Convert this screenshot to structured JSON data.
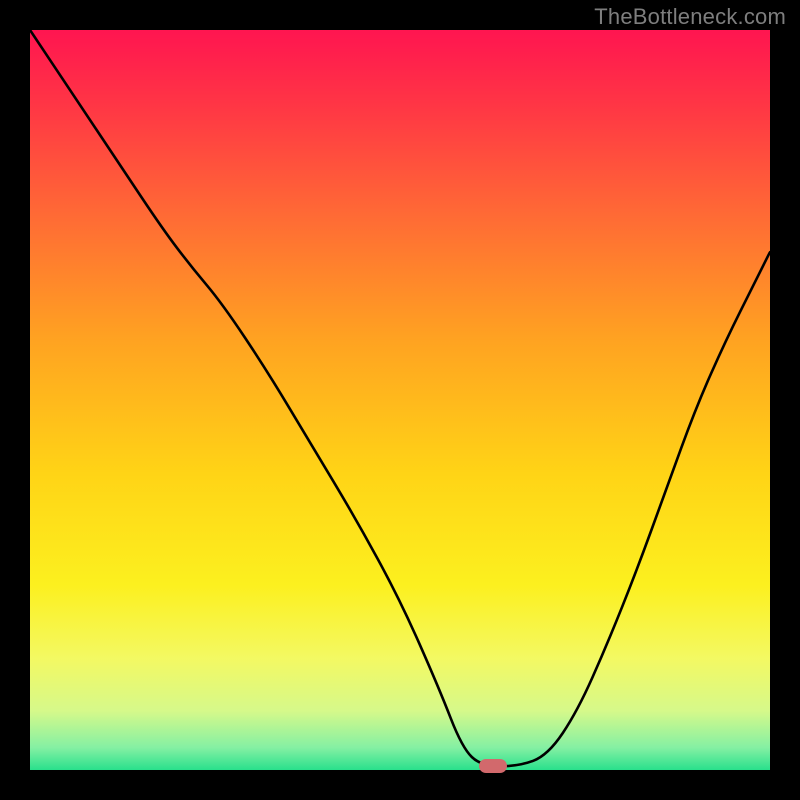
{
  "watermark": "TheBottleneck.com",
  "marker": {
    "x_norm": 0.625,
    "y_norm": 0.995
  },
  "gradient": {
    "colors": [
      {
        "stop": 0.0,
        "hex": "#ff1550"
      },
      {
        "stop": 0.1,
        "hex": "#ff3545"
      },
      {
        "stop": 0.25,
        "hex": "#ff6a35"
      },
      {
        "stop": 0.42,
        "hex": "#ffa321"
      },
      {
        "stop": 0.6,
        "hex": "#ffd416"
      },
      {
        "stop": 0.75,
        "hex": "#fcf01f"
      },
      {
        "stop": 0.85,
        "hex": "#f3f963"
      },
      {
        "stop": 0.92,
        "hex": "#d6f98a"
      },
      {
        "stop": 0.97,
        "hex": "#84f0a3"
      },
      {
        "stop": 1.0,
        "hex": "#29e08c"
      }
    ]
  },
  "chart_data": {
    "type": "line",
    "title": "",
    "xlabel": "",
    "ylabel": "",
    "x_range": [
      0,
      1
    ],
    "y_range": [
      0,
      1
    ],
    "series": [
      {
        "name": "bottleneck-curve",
        "x": [
          0.0,
          0.06,
          0.12,
          0.18,
          0.218,
          0.26,
          0.32,
          0.38,
          0.44,
          0.5,
          0.553,
          0.584,
          0.61,
          0.66,
          0.7,
          0.74,
          0.78,
          0.82,
          0.86,
          0.9,
          0.94,
          0.98,
          1.0
        ],
        "y": [
          1.0,
          0.91,
          0.82,
          0.73,
          0.68,
          0.63,
          0.54,
          0.44,
          0.34,
          0.23,
          0.11,
          0.03,
          0.005,
          0.005,
          0.02,
          0.08,
          0.17,
          0.27,
          0.38,
          0.49,
          0.58,
          0.66,
          0.7
        ]
      }
    ],
    "optimal_point": {
      "x": 0.625,
      "y": 0.0
    }
  }
}
